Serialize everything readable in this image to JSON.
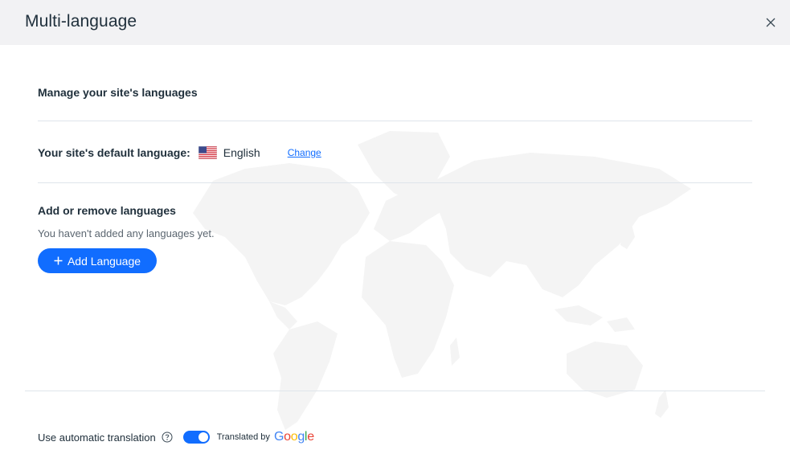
{
  "header": {
    "title": "Multi-language"
  },
  "icons": {
    "close": "close-icon",
    "help": "help-circle-icon",
    "plus": "plus-icon",
    "flag": "us-flag-icon"
  },
  "main": {
    "manage_title": "Manage your site's languages",
    "default_language": {
      "label": "Your site's default language:",
      "language": "English",
      "change_link": "Change"
    },
    "add_remove": {
      "title": "Add or remove languages",
      "empty_text": "You haven't added any languages yet.",
      "add_button": "Add Language"
    }
  },
  "footer": {
    "auto_translation_label": "Use automatic translation",
    "toggle_on": true,
    "translated_by": "Translated by",
    "provider": "Google"
  },
  "colors": {
    "accent": "#116dff",
    "header_bg": "#f2f2f4",
    "text": "#20303c",
    "divider": "#dfe5eb"
  }
}
